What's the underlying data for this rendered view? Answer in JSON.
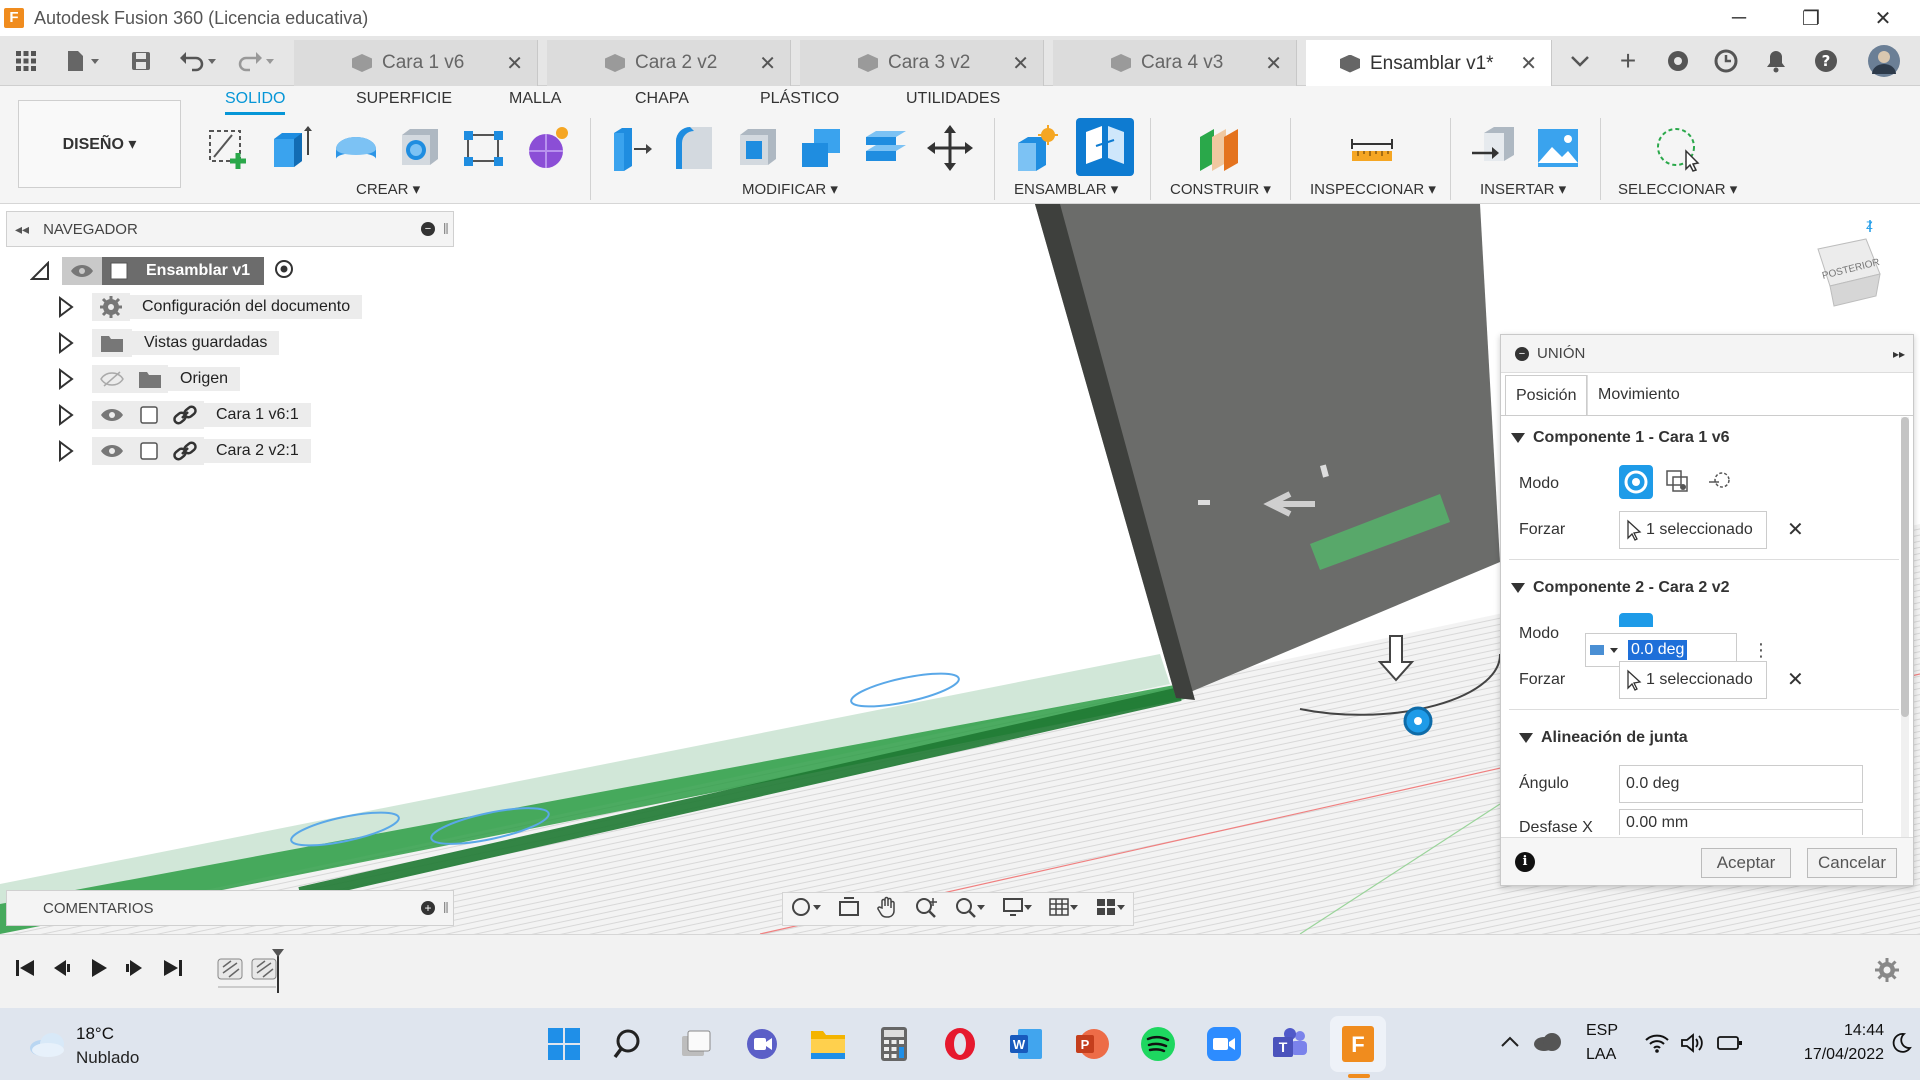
{
  "app": {
    "title": "Autodesk Fusion 360 (Licencia educativa)",
    "icon_letter": "F"
  },
  "window_controls": {
    "minimize": "─",
    "restore": "❐",
    "close": "✕"
  },
  "tabs": [
    {
      "label": "Cara 1 v6",
      "close": "✕"
    },
    {
      "label": "Cara 2 v2",
      "close": "✕"
    },
    {
      "label": "Cara 3 v2",
      "close": "✕"
    },
    {
      "label": "Cara 4 v3",
      "close": "✕"
    },
    {
      "label": "Ensamblar v1*",
      "close": "✕",
      "active": true
    }
  ],
  "ribbon": {
    "workspace": "DISEÑO ▾",
    "tabs": [
      "SOLIDO",
      "SUPERFICIE",
      "MALLA",
      "CHAPA",
      "PLÁSTICO",
      "UTILIDADES"
    ],
    "active_tab": "SOLIDO",
    "groups": [
      "CREAR ▾",
      "MODIFICAR ▾",
      "ENSAMBLAR ▾",
      "CONSTRUIR ▾",
      "INSPECCIONAR ▾",
      "INSERTAR ▾",
      "SELECCIONAR ▾"
    ]
  },
  "navigator": {
    "title": "NAVEGADOR",
    "root": "Ensamblar v1",
    "items": [
      "Configuración del documento",
      "Vistas guardadas",
      "Origen",
      "Cara 1 v6:1",
      "Cara 2 v2:1"
    ]
  },
  "comments": {
    "title": "COMENTARIOS"
  },
  "viewcube": {
    "label": "POSTERIOR",
    "axis": "Z"
  },
  "joint_panel": {
    "title": "UNIÓN",
    "tabs": [
      "Posición",
      "Movimiento"
    ],
    "active_tab": "Posición",
    "component1": {
      "header": "Componente 1 - Cara 1 v6",
      "mode_label": "Modo",
      "force_label": "Forzar",
      "selection": "1 seleccionado"
    },
    "component2": {
      "header": "Componente 2 - Cara 2 v2",
      "mode_label": "Modo",
      "force_label": "Forzar",
      "selection": "1 seleccionado",
      "angle_input": "0.0 deg"
    },
    "alignment": {
      "header": "Alineación de junta",
      "angle_label": "Ángulo",
      "angle_value": "0.0 deg",
      "offset_x_label": "Desfase X",
      "offset_x_value": "0.00 mm"
    },
    "accept": "Aceptar",
    "cancel": "Cancelar",
    "clear": "✕"
  },
  "taskbar": {
    "weather_temp": "18°C",
    "weather_desc": "Nublado",
    "lang_top": "ESP",
    "lang_bottom": "LAA",
    "time": "14:44",
    "date": "17/04/2022"
  },
  "colors": {
    "accent": "#0696d7",
    "brand": "#f08c1e",
    "plate_dark": "#5f605e",
    "green_part": "#2e9e47"
  }
}
